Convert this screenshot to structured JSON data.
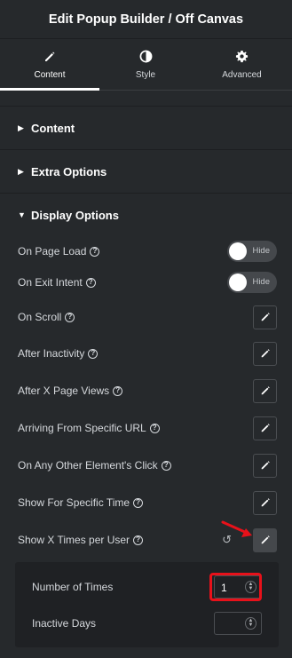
{
  "header": {
    "title": "Edit Popup Builder / Off Canvas"
  },
  "tabs": [
    {
      "label": "Content",
      "icon": "pencil-icon",
      "active": true
    },
    {
      "label": "Style",
      "icon": "half-circle-icon",
      "active": false
    },
    {
      "label": "Advanced",
      "icon": "gear-icon",
      "active": false
    }
  ],
  "sections": [
    {
      "title": "Content",
      "expanded": false
    },
    {
      "title": "Extra Options",
      "expanded": false
    },
    {
      "title": "Display Options",
      "expanded": true
    }
  ],
  "display_options": {
    "on_page_load": {
      "label": "On Page Load",
      "toggle_text": "Hide"
    },
    "on_exit_intent": {
      "label": "On Exit Intent",
      "toggle_text": "Hide"
    },
    "on_scroll": {
      "label": "On Scroll"
    },
    "after_inactivity": {
      "label": "After Inactivity"
    },
    "after_x_page_views": {
      "label": "After X Page Views"
    },
    "arriving_from_url": {
      "label": "Arriving From Specific URL"
    },
    "other_element_click": {
      "label": "On Any Other Element's Click"
    },
    "specific_time": {
      "label": "Show For Specific Time"
    },
    "x_times_per_user": {
      "label": "Show X Times per User"
    }
  },
  "popover": {
    "number_of_times": {
      "label": "Number of Times",
      "value": "1"
    },
    "inactive_days": {
      "label": "Inactive Days",
      "value": ""
    }
  },
  "help_glyph": "?",
  "colors": {
    "highlight": "#e8111a",
    "background": "#26292c",
    "popover": "#1f2124"
  }
}
